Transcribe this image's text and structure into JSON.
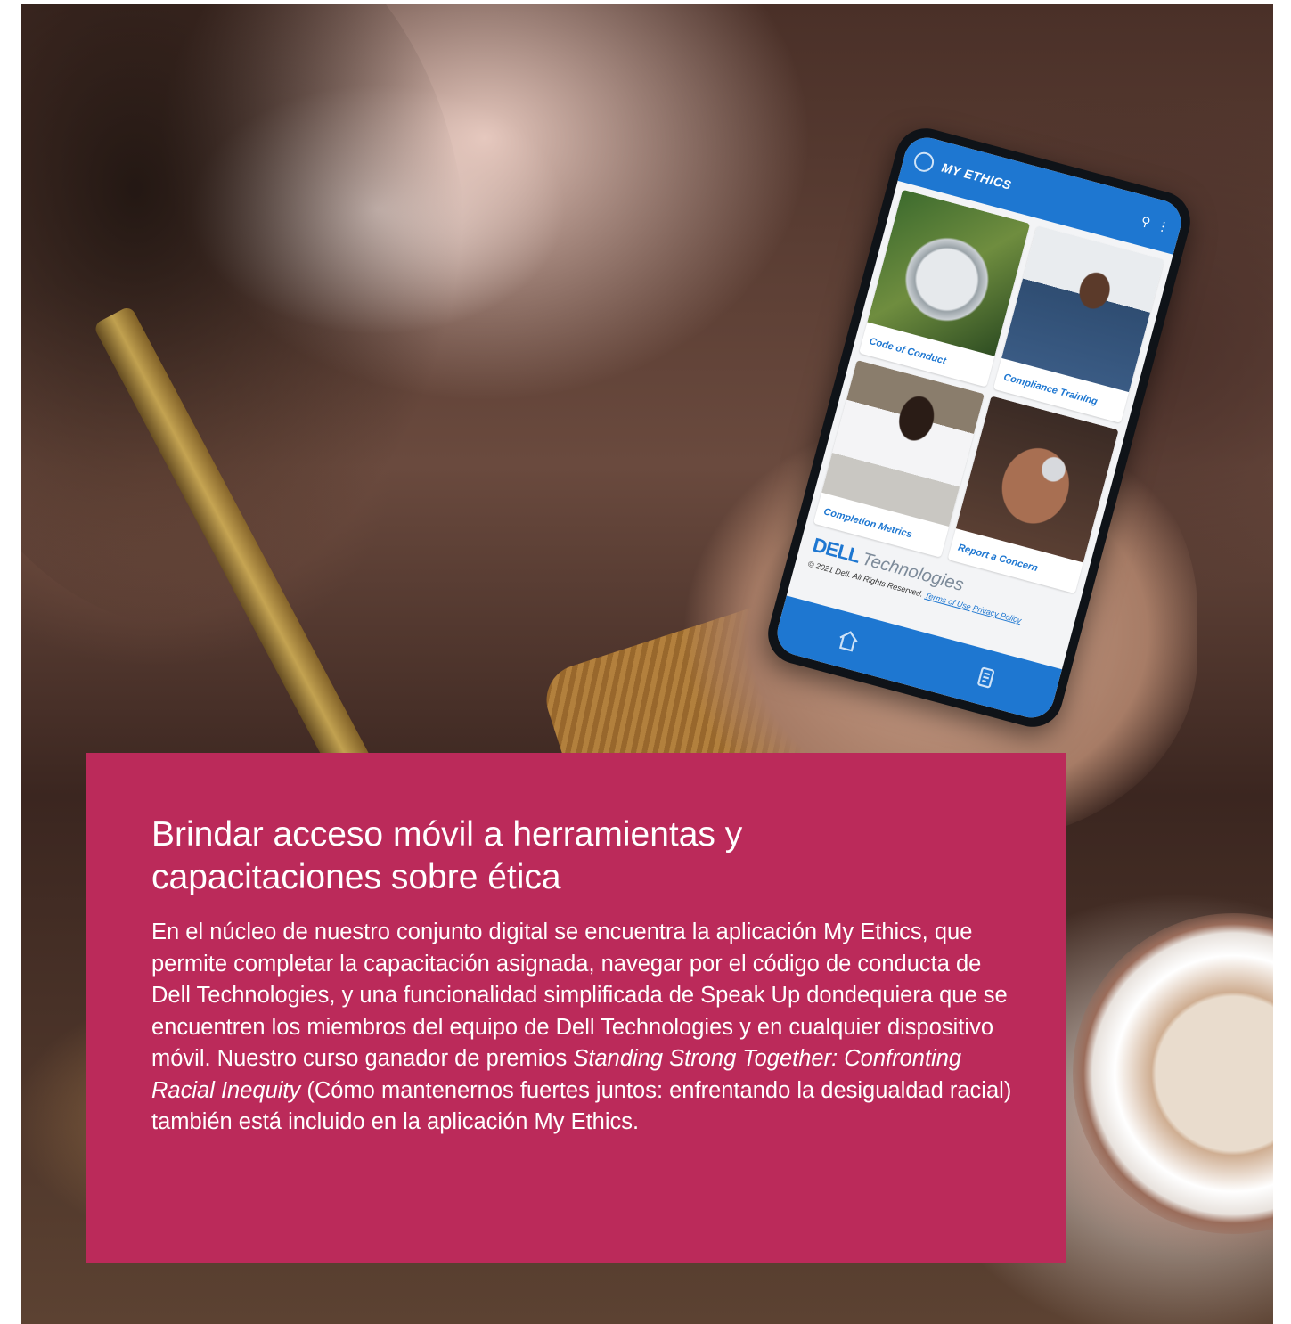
{
  "phone_app": {
    "title": "MY ETHICS",
    "tiles": [
      {
        "label": "Code of Conduct"
      },
      {
        "label": "Compliance Training"
      },
      {
        "label": "Completion Metrics"
      },
      {
        "label": "Report a Concern"
      }
    ],
    "brand_primary": "DELL",
    "brand_secondary": "Technologies",
    "copyright": "© 2021 Dell. All Rights Reserved.",
    "terms_link": "Terms of Use",
    "privacy_link": "Privacy Policy",
    "accent_color": "#1e77d1",
    "icons": [
      "search-icon",
      "more-vert-icon",
      "home-icon",
      "document-icon"
    ]
  },
  "feature": {
    "headline": "Brindar acceso móvil a herramientas y capacitaciones sobre ética",
    "body_part1": "En el núcleo de nuestro conjunto digital se encuentra la aplicación My Ethics, que permite completar la capacitación asignada, navegar por el código de conducta de Dell Technologies, y una funcionalidad simplificada de Speak Up dondequiera que se encuentren los miembros del equipo de Dell Technologies y en cualquier dispositivo móvil. Nuestro curso ganador de premios ",
    "body_italic": "Standing Strong Together: Confronting Racial Inequity",
    "body_part2": " (Cómo mantenernos fuertes juntos: enfrentando la desigualdad racial) también está incluido en la aplicación My Ethics.",
    "background_color": "#bb2a5a"
  }
}
